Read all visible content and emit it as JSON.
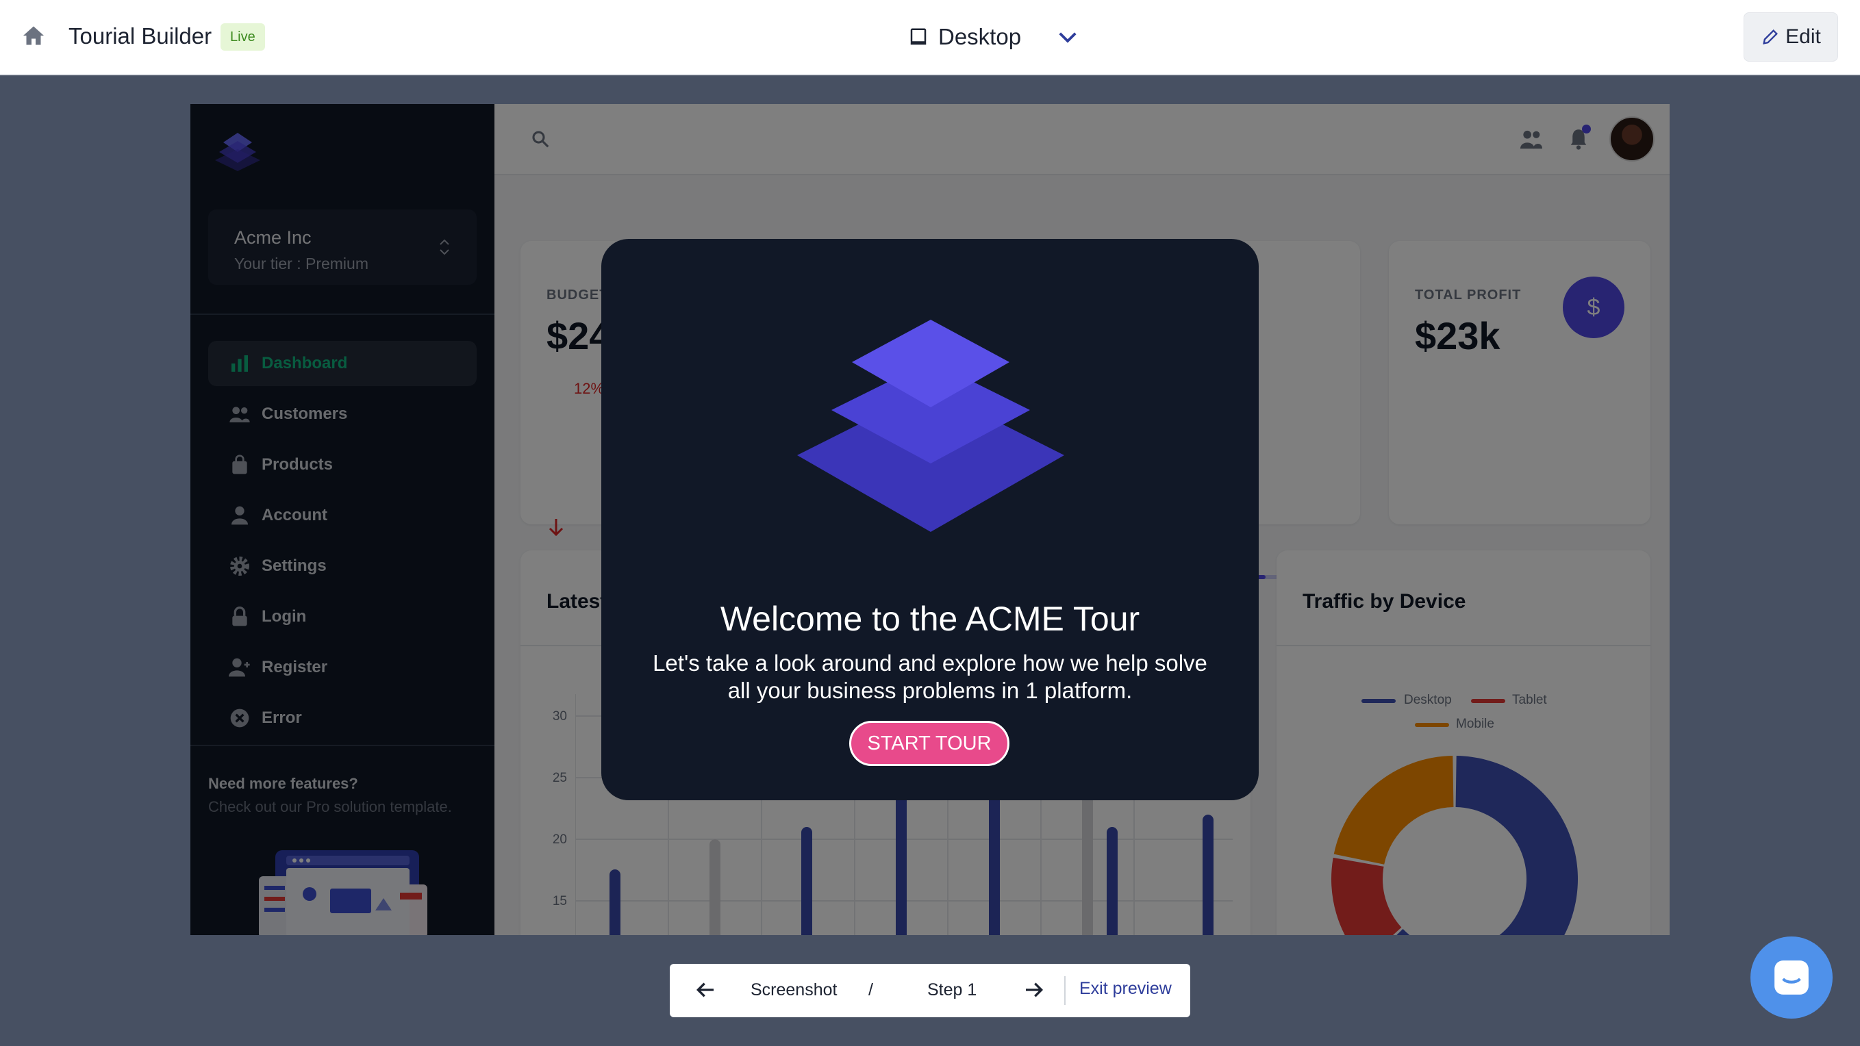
{
  "topbar": {
    "title": "Tourial Builder",
    "badge": "Live",
    "device": "Desktop",
    "edit_label": "Edit",
    "icons": [
      "home-icon",
      "laptop-icon",
      "chevron-down-icon",
      "pencil-icon"
    ]
  },
  "sidebar": {
    "org_name": "Acme Inc",
    "org_tier": "Your tier : Premium",
    "items": [
      {
        "label": "Dashboard",
        "icon": "bar-chart-icon",
        "active": true
      },
      {
        "label": "Customers",
        "icon": "users-icon",
        "active": false
      },
      {
        "label": "Products",
        "icon": "shopping-bag-icon",
        "active": false
      },
      {
        "label": "Account",
        "icon": "user-icon",
        "active": false
      },
      {
        "label": "Settings",
        "icon": "gear-icon",
        "active": false
      },
      {
        "label": "Login",
        "icon": "lock-icon",
        "active": false
      },
      {
        "label": "Register",
        "icon": "user-add-icon",
        "active": false
      },
      {
        "label": "Error",
        "icon": "error-circle-icon",
        "active": false
      }
    ],
    "promo_title": "Need more features?",
    "promo_text": "Check out our Pro solution template."
  },
  "dashboard": {
    "budget_label": "BUDGET",
    "budget_value": "$24",
    "budget_delta": "12%",
    "profit_label": "TOTAL PROFIT",
    "profit_value": "$23k",
    "profit_icon": "$",
    "latest_title": "Latest",
    "traffic_title": "Traffic by Device",
    "y_ticks": [
      "30",
      "25",
      "20",
      "15"
    ],
    "legend": [
      {
        "label": "Desktop",
        "color": "#3f51b5"
      },
      {
        "label": "Tablet",
        "color": "#e53935"
      },
      {
        "label": "Mobile",
        "color": "#fb8c00"
      }
    ]
  },
  "chart_data": {
    "type": "pie",
    "title": "Traffic by Device",
    "categories": [
      "Desktop",
      "Tablet",
      "Mobile"
    ],
    "values": [
      63,
      15,
      22
    ],
    "colors": [
      "#3f51b5",
      "#e53935",
      "#fb8c00"
    ]
  },
  "modal": {
    "title": "Welcome to the ACME Tour",
    "text": "Let's take a look around and explore how we help solve all your business problems in 1 platform.",
    "button_label": "START TOUR"
  },
  "bottom_nav": {
    "crumb_1": "Screenshot",
    "separator": "/",
    "crumb_2": "Step 1",
    "exit_label": "Exit preview"
  },
  "colors": {
    "accent": "#5048e5",
    "active_nav": "#10b981",
    "start_button": "#e84a8b",
    "chat_button": "#4f91ea"
  }
}
